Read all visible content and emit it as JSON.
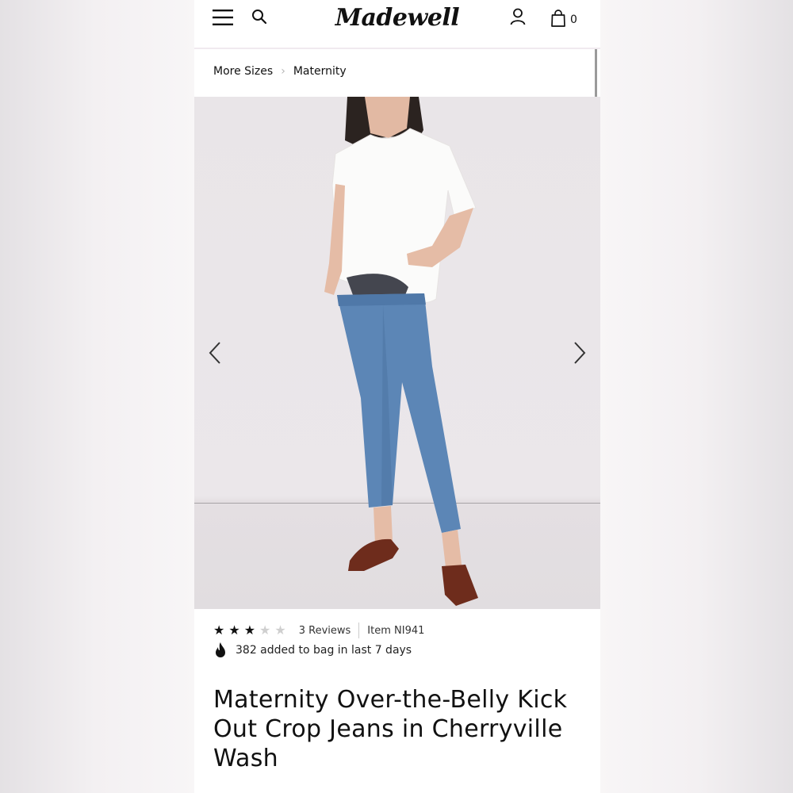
{
  "header": {
    "logo_text": "Madewell",
    "bag_count": "0",
    "icons": [
      "hamburger-menu-icon",
      "search-icon",
      "account-icon",
      "shopping-bag-icon"
    ]
  },
  "breadcrumb": {
    "items": [
      {
        "label": "More Sizes"
      },
      {
        "label": "Maternity"
      }
    ]
  },
  "gallery": {
    "prev_icon": "chevron-left-icon",
    "next_icon": "chevron-right-icon"
  },
  "product": {
    "rating": 3,
    "rating_max": 5,
    "reviews_label": "3 Reviews",
    "item_number": "Item NI941",
    "popularity_text": "382 added to bag in last 7 days",
    "title": "Maternity Over-the-Belly Kick Out Crop Jeans in Cherryville Wash"
  },
  "colors": {
    "text": "#111111",
    "star_filled": "#111111",
    "star_empty": "#cfcfcf",
    "page_background": "#f8f6f7"
  }
}
